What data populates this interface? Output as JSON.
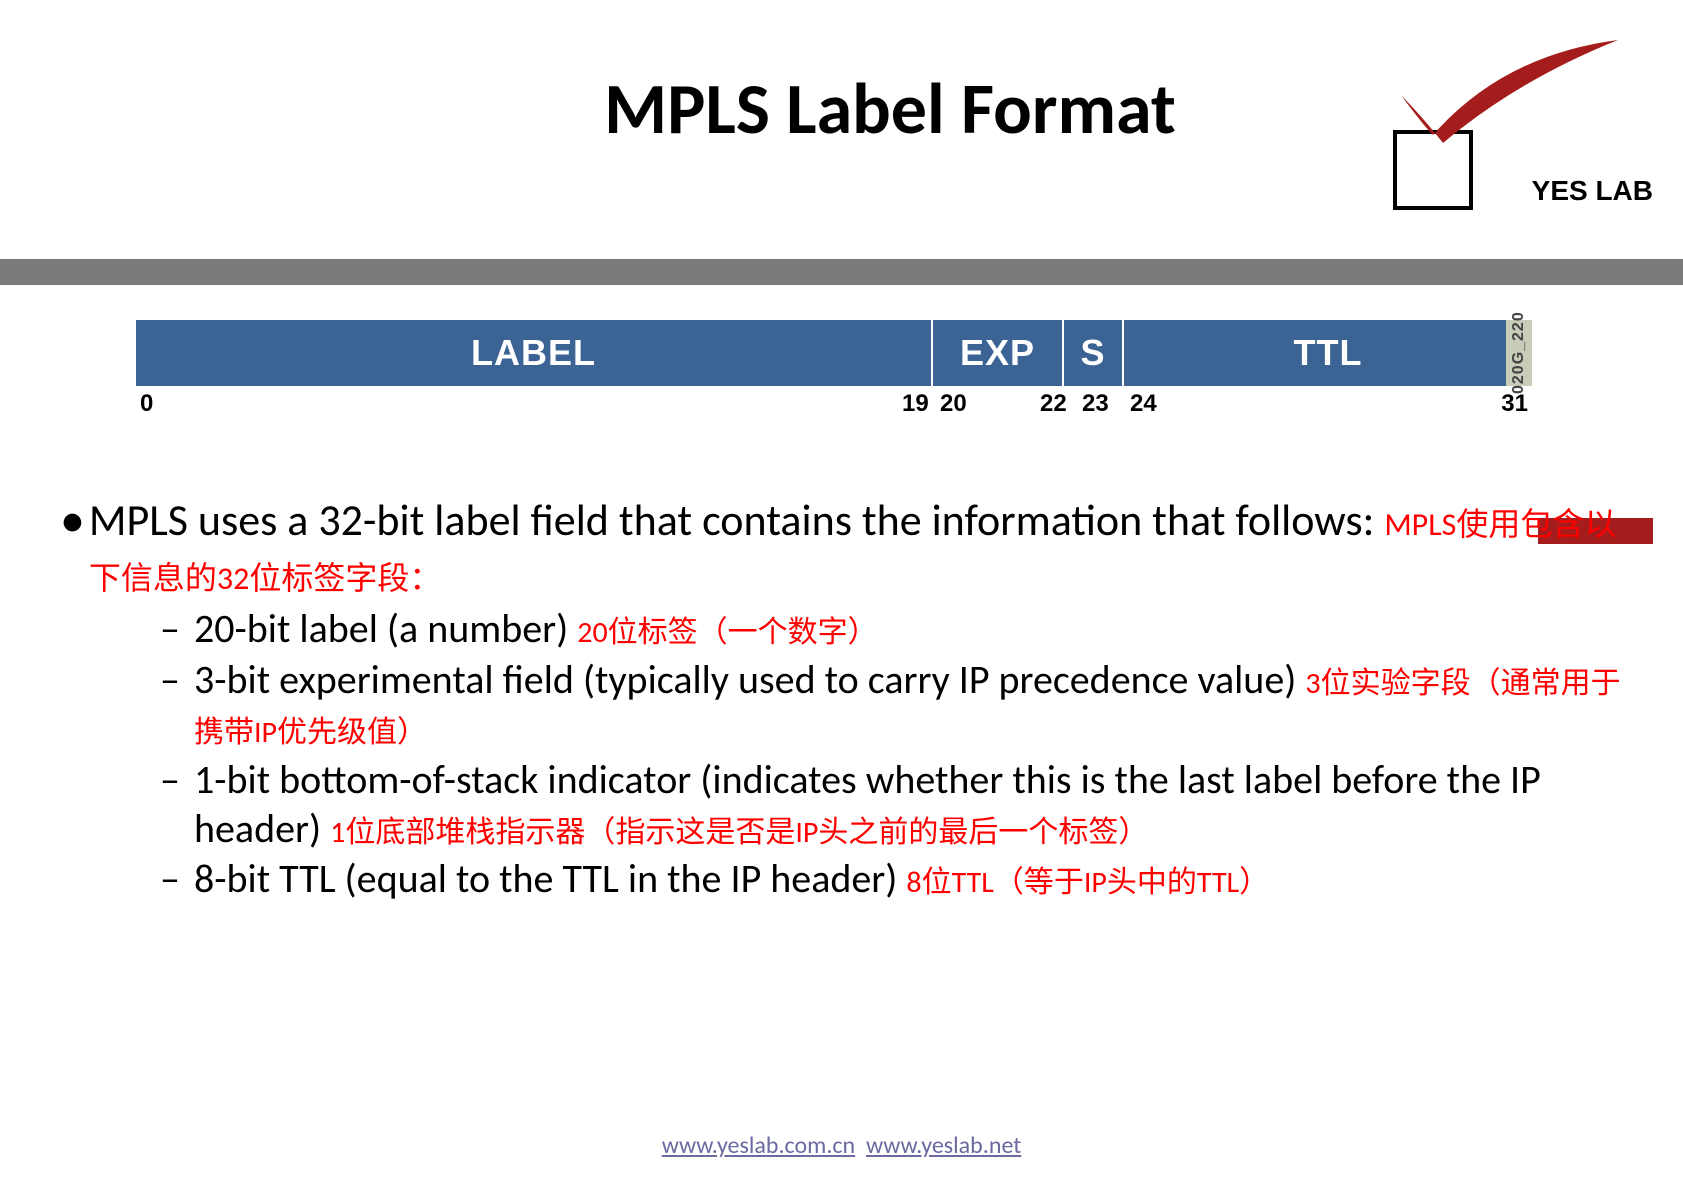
{
  "title": "MPLS Label Format",
  "brand": "YES LAB",
  "diagram": {
    "fields": {
      "label": "LABEL",
      "exp": "EXP",
      "s": "S",
      "ttl": "TTL"
    },
    "bits": {
      "b0": "0",
      "b19": "19",
      "b20": "20",
      "b22": "22",
      "b23": "23",
      "b24": "24",
      "b31": "31"
    },
    "image_id": "020G_220"
  },
  "bullet": {
    "main_en": "MPLS uses a 32-bit label field that contains the information that follows: ",
    "main_zh": "MPLS使用包含以下信息的32位标签字段：",
    "items": [
      {
        "en": "20-bit label (a number) ",
        "zh": "20位标签（一个数字）"
      },
      {
        "en": "3-bit experimental field (typically used to carry IP precedence value) ",
        "zh": "3位实验字段（通常用于携带IP优先级值）"
      },
      {
        "en": "1-bit bottom-of-stack indicator (indicates whether this  is the last label before the IP header) ",
        "zh": "1位底部堆栈指示器（指示这是否是IP头之前的最后一个标签）"
      },
      {
        "en": "8-bit TTL (equal to the TTL in the IP header) ",
        "zh": "8位TTL（等于IP头中的TTL）"
      }
    ]
  },
  "footer": {
    "link1": "www.yeslab.com.cn",
    "link2": "www.yeslab.net"
  }
}
